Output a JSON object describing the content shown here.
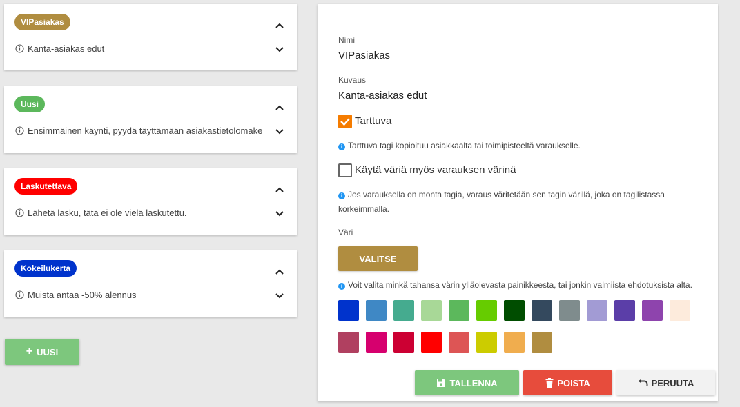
{
  "tags": [
    {
      "name": "VIPasiakas",
      "description": "Kanta-asiakas edut",
      "color": "#b08d40"
    },
    {
      "name": "Uusi",
      "description": "Ensimmäinen käynti, pyydä täyttämään asiakastietolomake",
      "color": "#5cb85c"
    },
    {
      "name": "Laskutettava",
      "description": "Lähetä lasku, tätä ei ole vielä laskutettu.",
      "color": "#ff0000"
    },
    {
      "name": "Kokeilukerta",
      "description": "Muista antaa -50% alennus",
      "color": "#0033cc"
    }
  ],
  "new_button": {
    "label": "UUSI",
    "icon": "plus-icon"
  },
  "form": {
    "name_label": "Nimi",
    "name_value": "VIPasiakas",
    "description_label": "Kuvaus",
    "description_value": "Kanta-asiakas edut",
    "sticky_label": "Tarttuva",
    "sticky_checked": true,
    "sticky_hint": "Tarttuva tagi kopioituu asiakkaalta tai toimipisteeltä varaukselle.",
    "use_color_label": "Käytä väriä myös varauksen värinä",
    "use_color_checked": false,
    "use_color_hint": "Jos varauksella on monta tagia, varaus väritetään sen tagin värillä, joka on tagilistassa korkeimmalla.",
    "color_label": "Väri",
    "choose_button": "VALITSE",
    "choose_color": "#b08d40",
    "color_hint": "Voit valita minkä tahansa värin ylläolevasta painikkeesta, tai jonkin valmiista ehdotuksista alta."
  },
  "swatches_row1": [
    "#0033cc",
    "#3f88c5",
    "#45ab8f",
    "#a8d897",
    "#5cb85c",
    "#66cc00",
    "#004d00",
    "#34495e",
    "#7f8c8d",
    "#a29bd4",
    "#5b3ea8",
    "#8e44ad",
    "#fdebdc"
  ],
  "swatches_row2": [
    "#b04060",
    "#d6006e",
    "#cc0033",
    "#ff0000",
    "#dd5555",
    "#cccc00",
    "#f0ad4e",
    "#b08d40"
  ],
  "actions": {
    "save": {
      "label": "TALLENNA",
      "icon": "save-icon",
      "color": "#7dc77d"
    },
    "delete": {
      "label": "POISTA",
      "icon": "trash-icon",
      "color": "#e74c3c"
    },
    "cancel": {
      "label": "PERUUTA",
      "icon": "undo-icon",
      "color": "#f2f2f2"
    }
  }
}
